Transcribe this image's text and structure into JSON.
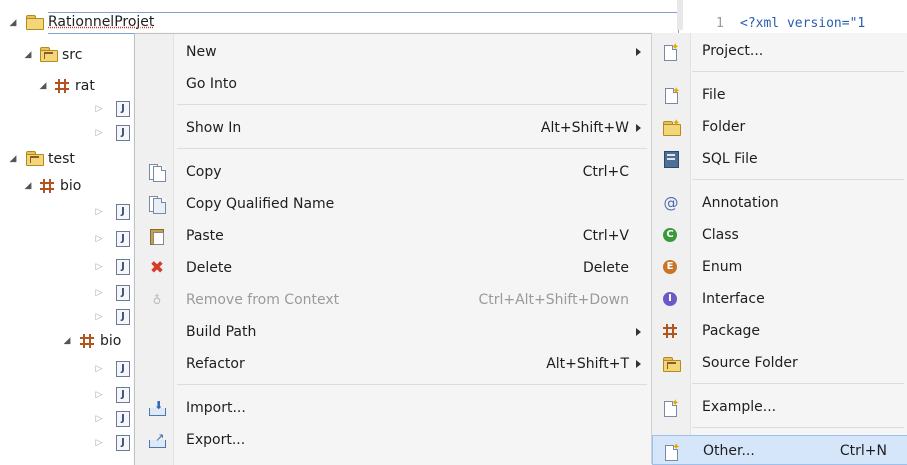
{
  "explorer": {
    "project": "RationnelProjet",
    "src_folder": "src",
    "src_package": "rat",
    "test_folder": "test",
    "test_package_1": "bio",
    "test_package_2": "bio"
  },
  "editor": {
    "line_number": "1",
    "first_line": "<?xml version=\"1"
  },
  "context_menu": {
    "items": [
      {
        "label": "New",
        "shortcut": "",
        "submenu": true
      },
      {
        "label": "Go Into",
        "shortcut": ""
      },
      {
        "label": "Show In",
        "shortcut": "Alt+Shift+W",
        "submenu": true
      },
      {
        "label": "Copy",
        "shortcut": "Ctrl+C"
      },
      {
        "label": "Copy Qualified Name",
        "shortcut": ""
      },
      {
        "label": "Paste",
        "shortcut": "Ctrl+V"
      },
      {
        "label": "Delete",
        "shortcut": "Delete"
      },
      {
        "label": "Remove from Context",
        "shortcut": "Ctrl+Alt+Shift+Down",
        "disabled": true
      },
      {
        "label": "Build Path",
        "shortcut": "",
        "submenu": true
      },
      {
        "label": "Refactor",
        "shortcut": "Alt+Shift+T",
        "submenu": true
      },
      {
        "label": "Import...",
        "shortcut": ""
      },
      {
        "label": "Export...",
        "shortcut": ""
      }
    ]
  },
  "new_submenu": {
    "items": [
      {
        "label": "Project...",
        "shortcut": ""
      },
      {
        "label": "File",
        "shortcut": ""
      },
      {
        "label": "Folder",
        "shortcut": ""
      },
      {
        "label": "SQL File",
        "shortcut": ""
      },
      {
        "label": "Annotation",
        "shortcut": ""
      },
      {
        "label": "Class",
        "shortcut": ""
      },
      {
        "label": "Enum",
        "shortcut": ""
      },
      {
        "label": "Interface",
        "shortcut": ""
      },
      {
        "label": "Package",
        "shortcut": ""
      },
      {
        "label": "Source Folder",
        "shortcut": ""
      },
      {
        "label": "Example...",
        "shortcut": ""
      },
      {
        "label": "Other...",
        "shortcut": "Ctrl+N"
      }
    ]
  },
  "colors": {
    "hover_bg": "#d6e6fa",
    "menu_bg": "#f5f5f5",
    "delete_red": "#d23c2a",
    "class_green": "#3a9a3a",
    "enum_orange": "#c8742a",
    "interface_purple": "#6a5ac8"
  }
}
